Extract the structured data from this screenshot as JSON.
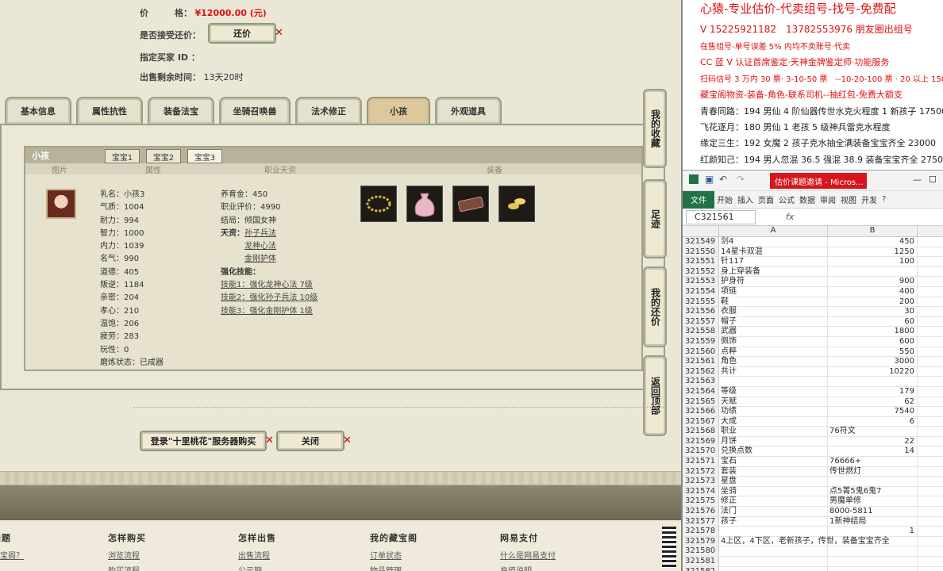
{
  "trade": {
    "price_label": "价　　　格：",
    "price_value": "¥12000.00 (元)",
    "bargain_label": "是否接受还价：",
    "bargain_button": "还价",
    "buyer_label": "指定买家 ID ：",
    "remaining_label": "出售剩余时间：",
    "remaining_value": "13天20时"
  },
  "tabs": [
    "基本信息",
    "属性抗性",
    "装备法宝",
    "坐骑召唤兽",
    "法术修正",
    "小孩",
    "外观道具"
  ],
  "active_tab": "小孩",
  "child_panel": {
    "title": "小孩",
    "subtabs": [
      "宝宝1",
      "宝宝2",
      "宝宝3"
    ],
    "active_subtab": "宝宝3",
    "col_headers": [
      "图片",
      "属性",
      "职业天资",
      "装备"
    ],
    "attributes": [
      "乳名：小孩3",
      "气质：1004",
      "耐力：994",
      "智力：1000",
      "内力：1039",
      "名气：990",
      "道德：405",
      "叛逆：1184",
      "亲密：204",
      "孝心：210",
      "温饱：206",
      "疲劳：283",
      "玩性：0",
      "磨炼状态：已成器"
    ],
    "career": {
      "lines": [
        "养育金：450",
        "职业评价：4990",
        "结局：倾国女神"
      ],
      "talent_label": "天资：",
      "talents": [
        "孙子兵法",
        "龙神心法",
        "金刚护体"
      ],
      "skill_label": "强化技能：",
      "skills": [
        "技能1：强化龙神心法 7级",
        "技能2：强化孙子兵法 10级",
        "技能3：强化金刚护体 1级"
      ]
    },
    "equipment_icons": [
      "necklace-icon",
      "pouch-icon",
      "book-icon",
      "coins-icon"
    ]
  },
  "side_buttons": [
    "我的收藏",
    "足迹",
    "我的还价",
    "返回顶部"
  ],
  "bottom_buttons": {
    "server_buy": "登录\"十里桃花\"服务器购买",
    "close": "关闭"
  },
  "footer": [
    {
      "h": "问题",
      "links": [
        "藏宝阁？"
      ]
    },
    {
      "h": "怎样购买",
      "links": [
        "浏览流程",
        "购买流程"
      ]
    },
    {
      "h": "怎样出售",
      "links": [
        "出售流程",
        "公示期"
      ]
    },
    {
      "h": "我的藏宝阁",
      "links": [
        "订单状态",
        "物品管理"
      ]
    },
    {
      "h": "网易支付",
      "links": [
        "什么是网易支付",
        "充值说明"
      ]
    }
  ],
  "doc": {
    "lines": [
      "心猿-专业估价-代卖组号-找号-免费配",
      "V 15225921182　13782553976 朋友圈出组号",
      "在售组号-单号误差 5% 内均不卖账号·代卖",
      "CC 蓝 V 认证首席鉴定·天神金牌鉴定师·功能服务",
      "扫码估号 3 万内 30 票· 3-10-50 票　--10-20-100 票 · 20 以上 150",
      "藏宝阁物资-装备-角色-联系司机--抽红包-免费大额支",
      "青春同路：194 男仙 4 阶仙器传世水克火程度 1 新孩子 17500",
      "飞花逐月：180 男仙 1 老孩 5 级神兵雷克水程度",
      "缘定三生：192 女魔 2 孩子克水抽全满装备宝宝齐全 23000",
      "红颜知己：194 男人忽混 36.5 强混 38.9 装备宝宝齐全 27500"
    ]
  },
  "excel": {
    "title": "估价课题邀请 - Micros...",
    "ribbon": [
      "文件",
      "开始",
      "插入",
      "页面",
      "公式",
      "数据",
      "审阅",
      "视图",
      "开发"
    ],
    "namebox": "C321561",
    "fx": "fx",
    "col_a": "A",
    "col_b": "B",
    "rows": [
      [
        "321549",
        "剑4",
        "450"
      ],
      [
        "321550",
        "14星卡双混",
        "1250"
      ],
      [
        "321551",
        "针117",
        "100"
      ],
      [
        "321552",
        "身上穿装备",
        ""
      ],
      [
        "321553",
        "护身符",
        "900"
      ],
      [
        "321554",
        "项链",
        "400"
      ],
      [
        "321555",
        "鞋",
        "200"
      ],
      [
        "321556",
        "衣服",
        "30"
      ],
      [
        "321557",
        "帽子",
        "60"
      ],
      [
        "321558",
        "武器",
        "1800"
      ],
      [
        "321559",
        "佩饰",
        "600"
      ],
      [
        "321560",
        "点粹",
        "550"
      ],
      [
        "321561",
        "角色",
        "3000"
      ],
      [
        "321562",
        "共计",
        "10220"
      ],
      [
        "321563",
        "",
        ""
      ],
      [
        "321564",
        "等级",
        "179"
      ],
      [
        "321565",
        "天赋",
        "62"
      ],
      [
        "321566",
        "功绩",
        "7540"
      ],
      [
        "321567",
        "大成",
        "6"
      ],
      [
        "321568",
        "职业",
        "76符文"
      ],
      [
        "321569",
        "月饼",
        "22"
      ],
      [
        "321570",
        "兑换点数",
        "14"
      ],
      [
        "321571",
        "宝石",
        "76666+"
      ],
      [
        "321572",
        "套装",
        "传世燃灯"
      ],
      [
        "321573",
        "星盘",
        ""
      ],
      [
        "321574",
        "坐骑",
        "点5菁5鬼6鬼7"
      ],
      [
        "321575",
        "修正",
        "男魔单修"
      ],
      [
        "321576",
        "法门",
        "8000-5811"
      ],
      [
        "321577",
        "孩子",
        "1新神结局"
      ],
      [
        "321578",
        "",
        "1"
      ],
      [
        "321579",
        "4上区，4下区，老新孩子，传世，装备宝宝齐全",
        ""
      ],
      [
        "321580",
        "",
        ""
      ],
      [
        "321581",
        "",
        ""
      ],
      [
        "321582",
        "",
        ""
      ]
    ]
  }
}
